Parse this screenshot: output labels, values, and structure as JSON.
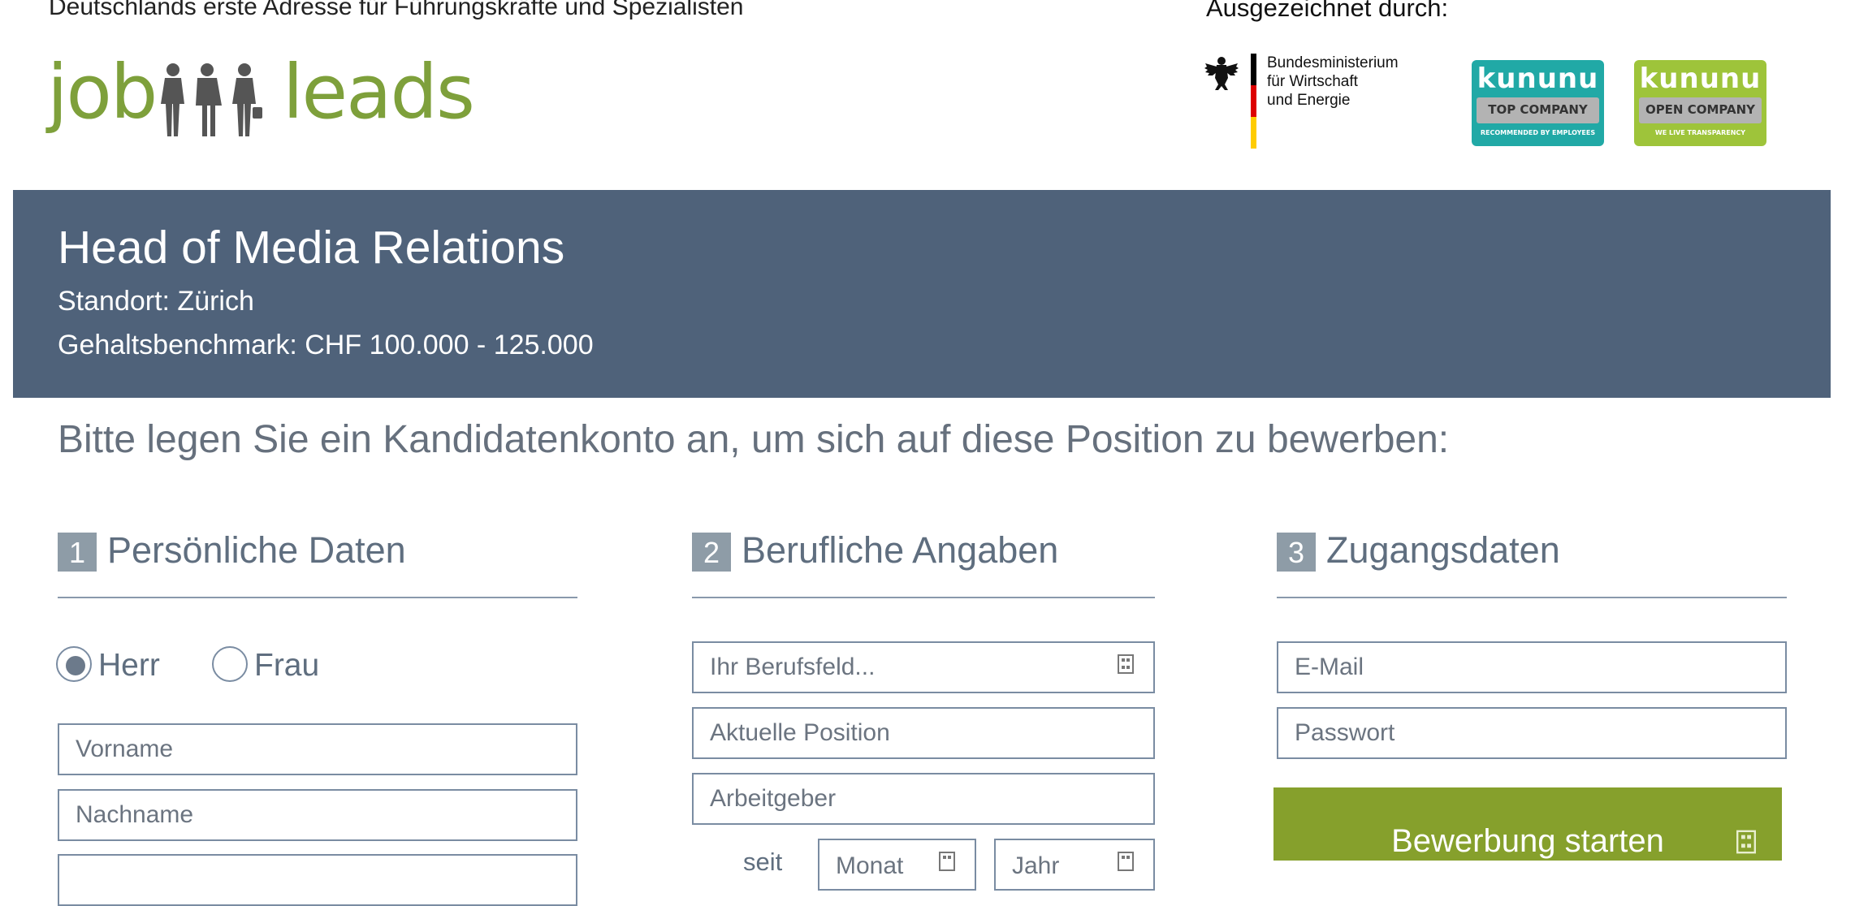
{
  "header": {
    "tagline": "Deutschlands erste Adresse für Führungskräfte und Spezialisten",
    "awarded_label": "Ausgezeichnet durch:",
    "logo": {
      "part1": "job",
      "part2": "leads",
      "brand_color": "#7ea03b"
    },
    "ministry": {
      "line1": "Bundesministerium",
      "line2": "für Wirtschaft",
      "line3": "und Energie"
    },
    "badges": [
      {
        "brand": "kununu",
        "label": "TOP COMPANY",
        "sub": "RECOMMENDED BY EMPLOYEES",
        "color": "#21a9a6"
      },
      {
        "brand": "kununu",
        "label": "OPEN COMPANY",
        "sub": "WE LIVE TRANSPARENCY",
        "color": "#9ec43a"
      }
    ]
  },
  "job": {
    "title": "Head of Media Relations",
    "location": "Standort: Zürich",
    "salary": "Gehaltsbenchmark: CHF 100.000 - 125.000",
    "bar_color": "#4f627a"
  },
  "intro": "Bitte legen Sie ein Kandidatenkonto an, um sich auf diese Position zu bewerben:",
  "sections": [
    {
      "num": "1",
      "label": "Persönliche Daten"
    },
    {
      "num": "2",
      "label": "Berufliche Angaben"
    },
    {
      "num": "3",
      "label": "Zugangsdaten"
    }
  ],
  "personal": {
    "salutation_options": [
      "Herr",
      "Frau"
    ],
    "salutation_selected": "Herr",
    "firstname_placeholder": "Vorname",
    "lastname_placeholder": "Nachname"
  },
  "professional": {
    "field_placeholder": "Ihr Berufsfeld...",
    "position_placeholder": "Aktuelle Position",
    "employer_placeholder": "Arbeitgeber",
    "since_label": "seit",
    "month_placeholder": "Monat",
    "year_placeholder": "Jahr"
  },
  "access": {
    "email_placeholder": "E-Mail",
    "password_placeholder": "Passwort",
    "submit_label": "Bewerbung starten",
    "submit_color": "#86a02c"
  },
  "icons": [
    "eagle-icon",
    "form-helper-icon"
  ]
}
